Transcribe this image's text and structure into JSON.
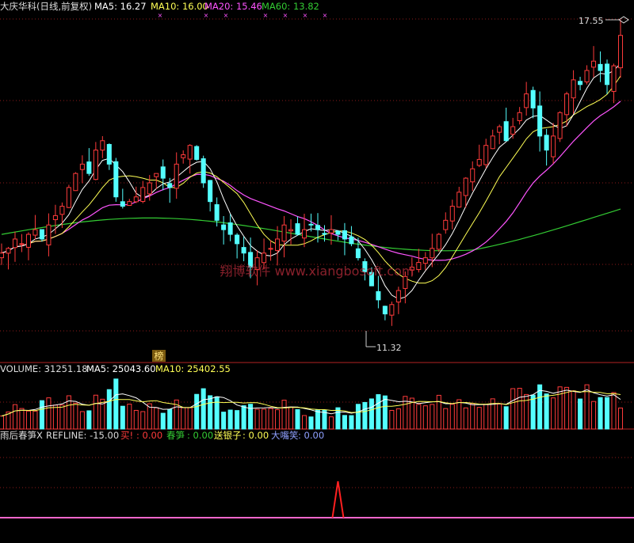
{
  "header": {
    "title": "大庆华科(日线,前复权)",
    "ma5": "MA5: 16.27",
    "ma10": "MA10: 16.00",
    "ma20": "MA20: 15.46",
    "ma60": "MA60: 13.82"
  },
  "price_panel": {
    "high_label": "17.55",
    "low_label": "11.32",
    "badge": "榜",
    "watermark": "翔博软件 www.xiangbosoft.com"
  },
  "volume_panel": {
    "volume": "VOLUME: 31251.18",
    "ma5": "MA5: 25043.60",
    "ma10": "MA10: 25402.55"
  },
  "indicator_panel": {
    "name": "雨后春笋X",
    "refline": "REFLINE: -15.00",
    "buy_label": "买!",
    "buy_value": ": 0.00",
    "sprout_label": "春笋",
    "sprout_value": ": 0.00",
    "silver_label": "送银子",
    "silver_value": ": 0.00",
    "laugh_label": "大嘴笑",
    "laugh_value": ": 0.00"
  },
  "colors": {
    "up": "#ff3b3b",
    "down": "#54ffff",
    "ma5": "#ffffff",
    "ma10": "#ffff55",
    "ma20": "#ff55ff",
    "ma60": "#33cc33",
    "grid": "#8b1a1a",
    "indicator_line": "#ff66cc",
    "signal": "#ff2020"
  },
  "chart_data": {
    "type": "candlestick",
    "price_range": [
      10.9,
      17.9
    ],
    "high": 17.55,
    "low": 11.32,
    "last_values": {
      "ma5": 16.27,
      "ma10": 16.0,
      "ma20": 15.46,
      "ma60": 13.82
    },
    "closes": [
      12.9,
      13.0,
      13.2,
      13.1,
      13.3,
      13.4,
      13.2,
      13.5,
      13.7,
      13.9,
      14.3,
      14.6,
      14.8,
      14.6,
      15.1,
      15.3,
      14.8,
      14.1,
      13.9,
      14.0,
      14.1,
      14.3,
      14.4,
      14.6,
      14.5,
      14.3,
      14.8,
      15.0,
      15.2,
      14.9,
      14.4,
      14.0,
      13.6,
      13.4,
      13.3,
      13.1,
      12.9,
      12.6,
      12.8,
      12.9,
      13.0,
      13.2,
      13.5,
      13.4,
      13.3,
      13.4,
      13.5,
      13.4,
      13.3,
      13.4,
      13.3,
      13.2,
      13.1,
      12.8,
      12.5,
      12.2,
      11.9,
      11.6,
      11.8,
      12.1,
      12.4,
      12.6,
      12.7,
      12.8,
      13.0,
      13.3,
      13.6,
      13.9,
      14.2,
      14.5,
      14.7,
      14.9,
      15.2,
      15.4,
      15.6,
      15.3,
      15.6,
      15.9,
      16.3,
      16.0,
      15.4,
      15.1,
      15.4,
      15.9,
      16.3,
      16.6,
      16.5,
      16.8,
      17.0,
      16.8,
      16.5,
      16.9,
      17.55
    ],
    "volume_range": [
      0,
      80000
    ],
    "volume_last": 31251.18,
    "volume_ma5_last": 25043.6,
    "volume_ma10_last": 25402.55,
    "indicator": {
      "refline": -15.0,
      "buy": 0.0,
      "sprout": 0.0,
      "silver": 0.0,
      "laugh": 0.0
    }
  }
}
